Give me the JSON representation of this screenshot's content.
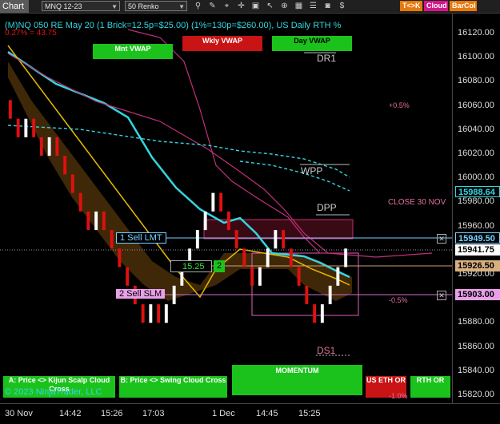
{
  "toolbar": {
    "tab_label": "Chart",
    "instrument": "MNQ 12-23",
    "bar_type": "50 Renko",
    "icons": [
      "magnifier-icon",
      "pencil-icon",
      "crosshair-icon",
      "plus-icon",
      "lock-icon",
      "arrow-icon",
      "link-icon",
      "grid-icon",
      "layers-icon",
      "camera-icon",
      "dollar-icon"
    ],
    "tk_label": "T<>K",
    "cloud_label": "Cloud",
    "barcol_label": "BarCol"
  },
  "header": {
    "title": "(M)NQ 050 RE May 20 (1 Brick=12.5p=$25.00) (1%=130p=$260.00), US Daily RTH %",
    "pct": "0.27% = 43.75"
  },
  "vwap_labels": {
    "mnt": "Mnt VWAP",
    "wkly": "Wkly VWAP",
    "day": "Day VWAP"
  },
  "levels": {
    "dr1": "DR1",
    "wpp": "WPP",
    "dpp": "DPP",
    "ds1": "DS1",
    "close": "CLOSE 30 NOV",
    "plus_pct": "+0.5%",
    "minus_pct": "-0.5%",
    "minus_1pct": "-1.0%"
  },
  "orders": {
    "sell_lmt": "1 Sell LMT",
    "sell_slm": "2 Sell SLM",
    "qty_value": "15.25",
    "qty_count": "2"
  },
  "price_axis": {
    "ticks": [
      "16120.00",
      "16100.00",
      "16080.00",
      "16060.00",
      "16040.00",
      "16020.00",
      "16000.00",
      "15980.00",
      "15960.00",
      "15940.00",
      "15920.00",
      "15900.00",
      "15880.00",
      "15860.00",
      "15840.00",
      "15820.00"
    ],
    "tag_cyan": "15988.64",
    "tag_sell_lmt": "15949.50",
    "tag_last": "15941.75",
    "tag_tan": "15926.50",
    "tag_sell_slm": "15903.00"
  },
  "time_axis": [
    "30 Nov",
    "14:42",
    "15:26",
    "17:03",
    "1 Dec",
    "14:45",
    "15:25"
  ],
  "bottom_buttons": {
    "kijun": "A: Price <> Kijun Scalp Cloud Cross",
    "swing": "B: Price <> Swing Cloud Cross",
    "momentum": "MOMENTUM",
    "us_eth": "US ETH OR",
    "rth": "RTH OR"
  },
  "copyright": "© 2023 NinjaTrader, LLC",
  "colors": {
    "up": "#ffffff",
    "down": "#e01010",
    "ma1": "#33d6e0",
    "ma2": "#e6b800",
    "vwap": "#c0307a",
    "bg": "#000000"
  },
  "chart_data": {
    "type": "candlestick",
    "ylim": [
      15815,
      16130
    ],
    "renko_bricks": [
      {
        "open": 16060,
        "close": 16045
      },
      {
        "open": 16045,
        "close": 16030
      },
      {
        "open": 16030,
        "close": 16045
      },
      {
        "open": 16045,
        "close": 16030
      },
      {
        "open": 16030,
        "close": 16015
      },
      {
        "open": 16015,
        "close": 16030
      },
      {
        "open": 16030,
        "close": 16015
      },
      {
        "open": 16015,
        "close": 16000
      },
      {
        "open": 16000,
        "close": 15985
      },
      {
        "open": 15985,
        "close": 15970
      },
      {
        "open": 15970,
        "close": 15955
      },
      {
        "open": 15955,
        "close": 15970
      },
      {
        "open": 15970,
        "close": 15955
      },
      {
        "open": 15955,
        "close": 15940
      },
      {
        "open": 15940,
        "close": 15925
      },
      {
        "open": 15925,
        "close": 15910
      },
      {
        "open": 15910,
        "close": 15895
      },
      {
        "open": 15895,
        "close": 15880
      },
      {
        "open": 15880,
        "close": 15895
      },
      {
        "open": 15895,
        "close": 15880
      },
      {
        "open": 15880,
        "close": 15895
      },
      {
        "open": 15895,
        "close": 15910
      },
      {
        "open": 15910,
        "close": 15925
      },
      {
        "open": 15925,
        "close": 15940
      },
      {
        "open": 15940,
        "close": 15955
      },
      {
        "open": 15955,
        "close": 15970
      },
      {
        "open": 15970,
        "close": 15985
      },
      {
        "open": 15985,
        "close": 15970
      },
      {
        "open": 15970,
        "close": 15955
      },
      {
        "open": 15955,
        "close": 15940
      },
      {
        "open": 15940,
        "close": 15925
      },
      {
        "open": 15925,
        "close": 15910
      },
      {
        "open": 15910,
        "close": 15925
      },
      {
        "open": 15925,
        "close": 15940
      },
      {
        "open": 15940,
        "close": 15955
      },
      {
        "open": 15955,
        "close": 15940
      },
      {
        "open": 15940,
        "close": 15925
      },
      {
        "open": 15925,
        "close": 15910
      },
      {
        "open": 15910,
        "close": 15895
      },
      {
        "open": 15895,
        "close": 15880
      },
      {
        "open": 15880,
        "close": 15895
      },
      {
        "open": 15895,
        "close": 15910
      },
      {
        "open": 15910,
        "close": 15925
      },
      {
        "open": 15925,
        "close": 15940
      }
    ]
  }
}
